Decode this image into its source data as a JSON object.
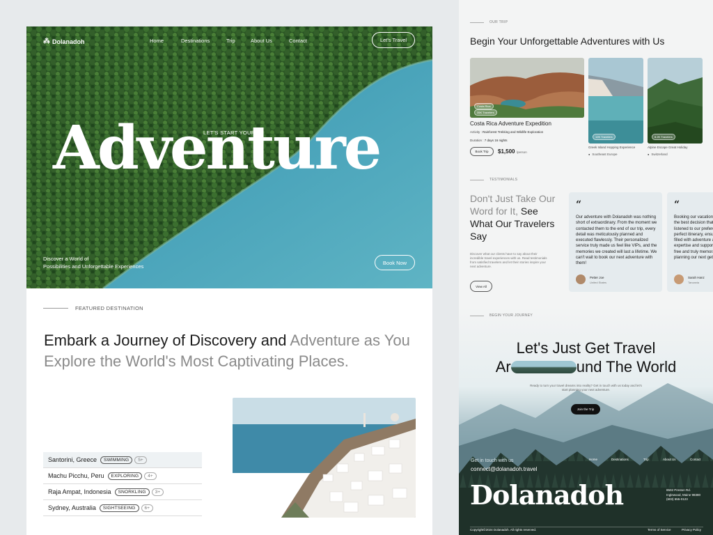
{
  "brand": "Dolanadoh",
  "nav": {
    "items": [
      "Home",
      "Destinations",
      "Trip",
      "About Us",
      "Contact"
    ],
    "cta": "Let's Travel"
  },
  "hero": {
    "subtitle": "LET'S START YOUR",
    "title": "Adventure",
    "description_line1": "Discover a World of",
    "description_line2": "Possibilities and Unforgettable Experiences",
    "button": "Book Now"
  },
  "featured": {
    "label": "FEATURED DESTINATION",
    "heading_dark": "Embark a Journey of Discovery and",
    "heading_grey": "Adventure as You Explore the World's Most Captivating Places.",
    "destinations": [
      {
        "name": "Santorini, Greece",
        "tag": "SWIMMING",
        "count": "5+"
      },
      {
        "name": "Machu Picchu, Peru",
        "tag": "EXPLORING",
        "count": "4+"
      },
      {
        "name": "Raja Ampat, Indonesia",
        "tag": "SNORKLING",
        "count": "3+"
      },
      {
        "name": "Sydney, Australia",
        "tag": "SIGHTSEEING",
        "count": "6+"
      }
    ]
  },
  "our_trip": {
    "label": "OUR TRIP",
    "title": "Begin Your Unforgettable Adventures with Us",
    "main": {
      "badge": "Costa Rica",
      "travelers": "35K Travelers",
      "title": "Costa Rica Adventure Expedition",
      "activity_label": "Activity :",
      "activity": "Rainforest Trekking and Wildlife Exploration",
      "duration_label": "Duration :",
      "duration": "7 days 16 nights",
      "button": "Book Trip",
      "price": "$1,500",
      "price_unit": "/person"
    },
    "cards": [
      {
        "title": "Greek Island Hopping Experience",
        "location": "Southeast Europe",
        "travelers": "12K Travelers"
      },
      {
        "title": "Alpine Escape Great Holiday",
        "location": "Switzerland",
        "travelers": "8.2K Travelers"
      }
    ]
  },
  "testimonials": {
    "label": "TESTIMONIALS",
    "heading_grey": "Don't Just Take Our Word for It,",
    "heading_dark": "See What Our Travelers Say",
    "description": "Discover what our clients have to say about their incredible travel experiences with us. Read testimonials from satisfied travelers and let their stories inspire your next adventure.",
    "button": "View All",
    "items": [
      {
        "quote": "Our adventure with Dolanadoh was nothing short of extraordinary. From the moment we contacted them to the end of our trip, every detail was meticulously planned and executed flawlessly. Their personalized service truly made us feel like VIPs, and the memories we created will last a lifetime. We can't wait to book our next adventure with them!",
        "name": "Petter Joe",
        "location": "United States"
      },
      {
        "quote": "Booking our vacation with Dolanadoh was the best decision that we've made. They listened to our preferences and crafted the perfect itinerary, ensuring that each day was filled with adventure and relaxation. Their expertise and support made our trip stress-free and truly memorable. We're already planning our next getaway",
        "name": "Sarah Hanz",
        "location": "Tanzania"
      }
    ]
  },
  "journey": {
    "label": "BEGIN YOUR JOURNEY",
    "title_line1": "Let's Just Get Travel",
    "title_line2_start": "Ar",
    "title_line2_end": "und The World",
    "description": "Ready to turn your travel dreams into reality? Get in touch with us today and let's start planning your next adventure.",
    "button": "Join the Trip"
  },
  "footer": {
    "touch": "Get in touch with us",
    "email": "connect@dolanadoh.travel",
    "nav": [
      "Home",
      "Destinations",
      "Trip",
      "About Us",
      "Contact"
    ],
    "address": [
      "8502 Preston Rd.",
      "Inglewood, Maine 98380",
      "(603) 555-0123"
    ],
    "copyright": "Copyright©2024 Dolanadoh. All rights reserved.",
    "terms": "Terms of Service",
    "privacy": "Privacy Policy"
  },
  "colors": {
    "sea": "#3a9ab8",
    "forest": "#2e5a2a",
    "card_bg": "#e5ebee",
    "dark_button": "#111111"
  }
}
